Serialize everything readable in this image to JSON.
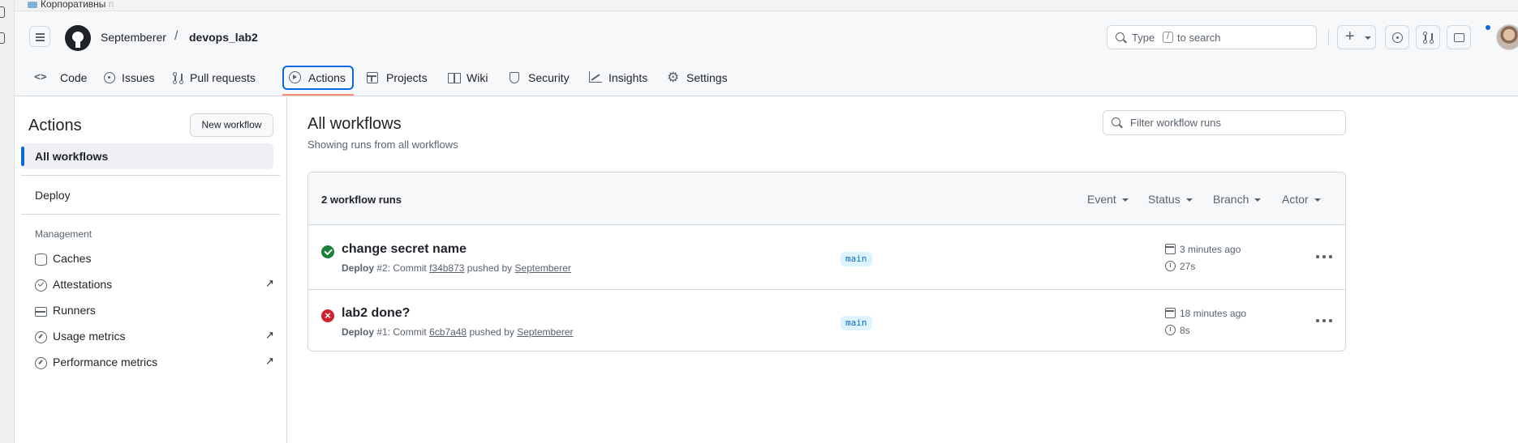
{
  "browser": {
    "bookmark": "Корпоративны",
    "bookmark_faded": "п"
  },
  "header": {
    "owner": "Septemberer",
    "separator": "/",
    "repo": "devops_lab2",
    "search": {
      "prefix": "Type",
      "key": "/",
      "suffix": "to search"
    },
    "plus_label": "+",
    "accent": "#0969da"
  },
  "tabs": [
    {
      "label": "Code",
      "icon": "code-icon"
    },
    {
      "label": "Issues",
      "icon": "issue-opened-icon"
    },
    {
      "label": "Pull requests",
      "icon": "git-pull-request-icon"
    },
    {
      "label": "Actions",
      "icon": "play-icon",
      "selected": true
    },
    {
      "label": "Projects",
      "icon": "table-icon"
    },
    {
      "label": "Wiki",
      "icon": "book-icon"
    },
    {
      "label": "Security",
      "icon": "shield-icon"
    },
    {
      "label": "Insights",
      "icon": "graph-icon"
    },
    {
      "label": "Settings",
      "icon": "gear-icon"
    }
  ],
  "sidebar": {
    "title": "Actions",
    "new_workflow": "New workflow",
    "all_workflows": "All workflows",
    "workflows": [
      "Deploy"
    ],
    "section": "Management",
    "items": [
      {
        "label": "Caches",
        "icon": "database-icon",
        "external": false
      },
      {
        "label": "Attestations",
        "icon": "check-circle-icon",
        "external": true
      },
      {
        "label": "Runners",
        "icon": "server-icon",
        "external": false
      },
      {
        "label": "Usage metrics",
        "icon": "meter-icon",
        "external": true
      },
      {
        "label": "Performance metrics",
        "icon": "meter-icon",
        "external": true
      }
    ],
    "external_glyph": "↗"
  },
  "main": {
    "title": "All workflows",
    "subtitle": "Showing runs from all workflows",
    "filter_placeholder": "Filter workflow runs",
    "runs_count": "2 workflow runs",
    "filters": [
      "Event",
      "Status",
      "Branch",
      "Actor"
    ],
    "runs": [
      {
        "title": "change secret name",
        "status": "success",
        "workflow": "Deploy",
        "run_number": "#2",
        "commit_prefix": ": Commit",
        "commit": "f34b873",
        "pushed_by": "pushed by",
        "actor": "Septemberer",
        "branch": "main",
        "time": "3 minutes ago",
        "duration": "27s"
      },
      {
        "title": "lab2 done?",
        "status": "failure",
        "workflow": "Deploy",
        "run_number": "#1",
        "commit_prefix": ": Commit",
        "commit": "6cb7a48",
        "pushed_by": "pushed by",
        "actor": "Septemberer",
        "branch": "main",
        "time": "18 minutes ago",
        "duration": "8s"
      }
    ],
    "status_colors": {
      "success": "#1a7f37",
      "failure": "#cf222e"
    }
  }
}
